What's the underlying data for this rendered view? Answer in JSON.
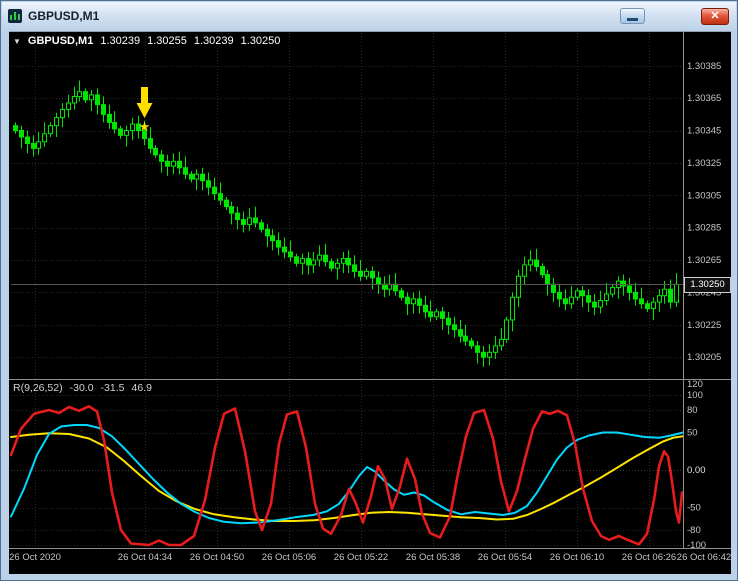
{
  "window": {
    "title": "GBPUSD,M1",
    "controls": {
      "close_glyph": "✕"
    }
  },
  "header": {
    "collapse_glyph": "▼",
    "symbol": "GBPUSD,M1",
    "open": "1.30239",
    "high": "1.30255",
    "low": "1.30239",
    "close": "1.30250"
  },
  "price_box": {
    "value": "1.30250"
  },
  "oscillator_label": {
    "name": "R(9,26,52)",
    "v1": "-30.0",
    "v2": "-31.5",
    "v3": "46.9"
  },
  "colors": {
    "candle": "#00e600",
    "grid": "#292929",
    "frame": "#8f8f8f",
    "axis_text": "#c6c6c6",
    "annotation": "#ffdf00",
    "price_line": "#565656"
  },
  "chart_data": {
    "type": "candlestick",
    "title": "GBPUSD,M1",
    "price_base": 1.3,
    "unit": 1e-05,
    "current_price": 1.3025,
    "price_axis_ticks": [
      "1.30385",
      "1.30365",
      "1.30345",
      "1.30325",
      "1.30305",
      "1.30285",
      "1.30265",
      "1.30245",
      "1.30225",
      "1.30205"
    ],
    "time_ticks": [
      "26 Oct 2020",
      "26 Oct 04:34",
      "26 Oct 04:50",
      "26 Oct 05:06",
      "26 Oct 05:22",
      "26 Oct 05:38",
      "26 Oct 05:54",
      "26 Oct 06:10",
      "26 Oct 06:26",
      "26 Oct 06:42"
    ],
    "first_open": 348,
    "closes": [
      345,
      341,
      337,
      334,
      338,
      343,
      348,
      353,
      358,
      362,
      366,
      369,
      364,
      367,
      361,
      355,
      350,
      346,
      342,
      345,
      349,
      345,
      340,
      334,
      330,
      326,
      323,
      326,
      322,
      318,
      315,
      318,
      314,
      310,
      306,
      302,
      298,
      294,
      290,
      287,
      291,
      288,
      284,
      280,
      277,
      273,
      270,
      267,
      263,
      266,
      262,
      265,
      268,
      264,
      260,
      263,
      266,
      262,
      258,
      255,
      258,
      254,
      250,
      247,
      250,
      246,
      242,
      238,
      241,
      237,
      233,
      230,
      233,
      229,
      225,
      222,
      218,
      215,
      212,
      208,
      205,
      208,
      212,
      216,
      228,
      242,
      255,
      262,
      265,
      261,
      256,
      250,
      245,
      241,
      238,
      242,
      246,
      243,
      239,
      236,
      240,
      244,
      248,
      252,
      249,
      245,
      241,
      238,
      235,
      239,
      243,
      247,
      239,
      250
    ],
    "annotations": [
      {
        "type": "down-arrow",
        "candle_index": 22,
        "color": "#ffdf00"
      },
      {
        "type": "star",
        "glyph": "★",
        "candle_index": 22,
        "color": "#ffdf00"
      }
    ],
    "oscillator": {
      "label": "R(9,26,52)",
      "current_values": [
        -30.0,
        -31.5,
        46.9
      ],
      "levels": [
        120,
        100,
        80,
        50,
        0,
        -50,
        -80,
        -100
      ],
      "level_labels": [
        "120",
        "100",
        "80",
        "50",
        "0.00",
        "-50",
        "-80",
        "-100"
      ],
      "series": [
        {
          "name": "signal-yellow",
          "color": "#ffe400",
          "width": 2,
          "points": [
            [
              2,
              44
            ],
            [
              20,
              47
            ],
            [
              40,
              49
            ],
            [
              60,
              48
            ],
            [
              80,
              42
            ],
            [
              98,
              30
            ],
            [
              115,
              12
            ],
            [
              132,
              -8
            ],
            [
              150,
              -28
            ],
            [
              168,
              -42
            ],
            [
              186,
              -52
            ],
            [
              205,
              -59
            ],
            [
              225,
              -63
            ],
            [
              245,
              -66
            ],
            [
              265,
              -68
            ],
            [
              285,
              -68
            ],
            [
              305,
              -67
            ],
            [
              325,
              -64
            ],
            [
              345,
              -60
            ],
            [
              362,
              -57
            ],
            [
              380,
              -56
            ],
            [
              398,
              -57
            ],
            [
              416,
              -59
            ],
            [
              434,
              -61
            ],
            [
              452,
              -63
            ],
            [
              470,
              -64
            ],
            [
              488,
              -66
            ],
            [
              504,
              -65
            ],
            [
              518,
              -60
            ],
            [
              532,
              -52
            ],
            [
              546,
              -43
            ],
            [
              560,
              -33
            ],
            [
              576,
              -22
            ],
            [
              592,
              -10
            ],
            [
              608,
              3
            ],
            [
              624,
              16
            ],
            [
              640,
              28
            ],
            [
              654,
              38
            ],
            [
              664,
              43
            ],
            [
              674,
              45
            ]
          ]
        },
        {
          "name": "slow-cyan",
          "color": "#00d9ff",
          "width": 2,
          "points": [
            [
              2,
              -62
            ],
            [
              15,
              -25
            ],
            [
              28,
              20
            ],
            [
              40,
              48
            ],
            [
              52,
              58
            ],
            [
              65,
              60
            ],
            [
              78,
              60
            ],
            [
              90,
              56
            ],
            [
              103,
              45
            ],
            [
              116,
              28
            ],
            [
              130,
              8
            ],
            [
              144,
              -12
            ],
            [
              158,
              -30
            ],
            [
              172,
              -45
            ],
            [
              186,
              -56
            ],
            [
              200,
              -64
            ],
            [
              215,
              -69
            ],
            [
              232,
              -71
            ],
            [
              250,
              -70
            ],
            [
              268,
              -67
            ],
            [
              286,
              -63
            ],
            [
              304,
              -60
            ],
            [
              318,
              -55
            ],
            [
              330,
              -45
            ],
            [
              340,
              -28
            ],
            [
              350,
              -8
            ],
            [
              358,
              4
            ],
            [
              366,
              -2
            ],
            [
              375,
              -14
            ],
            [
              385,
              -26
            ],
            [
              395,
              -33
            ],
            [
              405,
              -30
            ],
            [
              415,
              -34
            ],
            [
              425,
              -43
            ],
            [
              438,
              -53
            ],
            [
              452,
              -59
            ],
            [
              466,
              -56
            ],
            [
              480,
              -58
            ],
            [
              494,
              -60
            ],
            [
              506,
              -57
            ],
            [
              518,
              -48
            ],
            [
              528,
              -30
            ],
            [
              538,
              -8
            ],
            [
              548,
              14
            ],
            [
              558,
              30
            ],
            [
              568,
              40
            ],
            [
              580,
              46
            ],
            [
              594,
              50
            ],
            [
              608,
              50
            ],
            [
              622,
              47
            ],
            [
              636,
              44
            ],
            [
              650,
              43
            ],
            [
              662,
              46
            ],
            [
              674,
              50
            ]
          ]
        },
        {
          "name": "fast-red",
          "color": "#e81c1c",
          "width": 2.6,
          "points": [
            [
              2,
              20
            ],
            [
              12,
              55
            ],
            [
              25,
              75
            ],
            [
              40,
              80
            ],
            [
              50,
              76
            ],
            [
              60,
              84
            ],
            [
              70,
              79
            ],
            [
              80,
              85
            ],
            [
              88,
              78
            ],
            [
              95,
              40
            ],
            [
              103,
              -30
            ],
            [
              112,
              -80
            ],
            [
              122,
              -98
            ],
            [
              140,
              -100
            ],
            [
              150,
              -94
            ],
            [
              160,
              -100
            ],
            [
              172,
              -100
            ],
            [
              185,
              -88
            ],
            [
              196,
              -40
            ],
            [
              206,
              30
            ],
            [
              215,
              75
            ],
            [
              226,
              82
            ],
            [
              236,
              25
            ],
            [
              246,
              -55
            ],
            [
              253,
              -80
            ],
            [
              262,
              -45
            ],
            [
              270,
              35
            ],
            [
              278,
              74
            ],
            [
              288,
              78
            ],
            [
              297,
              30
            ],
            [
              306,
              -45
            ],
            [
              314,
              -78
            ],
            [
              322,
              -85
            ],
            [
              332,
              -60
            ],
            [
              340,
              -25
            ],
            [
              347,
              -45
            ],
            [
              354,
              -70
            ],
            [
              362,
              -35
            ],
            [
              369,
              5
            ],
            [
              376,
              -12
            ],
            [
              383,
              -52
            ],
            [
              391,
              -22
            ],
            [
              398,
              15
            ],
            [
              406,
              -12
            ],
            [
              413,
              -58
            ],
            [
              421,
              -84
            ],
            [
              431,
              -90
            ],
            [
              441,
              -62
            ],
            [
              449,
              -5
            ],
            [
              457,
              45
            ],
            [
              465,
              76
            ],
            [
              475,
              80
            ],
            [
              484,
              42
            ],
            [
              492,
              -15
            ],
            [
              500,
              -55
            ],
            [
              508,
              -28
            ],
            [
              516,
              15
            ],
            [
              524,
              55
            ],
            [
              533,
              78
            ],
            [
              541,
              75
            ],
            [
              549,
              79
            ],
            [
              558,
              73
            ],
            [
              566,
              35
            ],
            [
              574,
              -25
            ],
            [
              583,
              -68
            ],
            [
              592,
              -88
            ],
            [
              600,
              -93
            ],
            [
              610,
              -88
            ],
            [
              620,
              -94
            ],
            [
              630,
              -99
            ],
            [
              638,
              -85
            ],
            [
              645,
              -40
            ],
            [
              650,
              5
            ],
            [
              655,
              25
            ],
            [
              659,
              18
            ],
            [
              663,
              -15
            ],
            [
              667,
              -55
            ],
            [
              670,
              -70
            ],
            [
              673,
              -30
            ]
          ]
        }
      ]
    }
  }
}
